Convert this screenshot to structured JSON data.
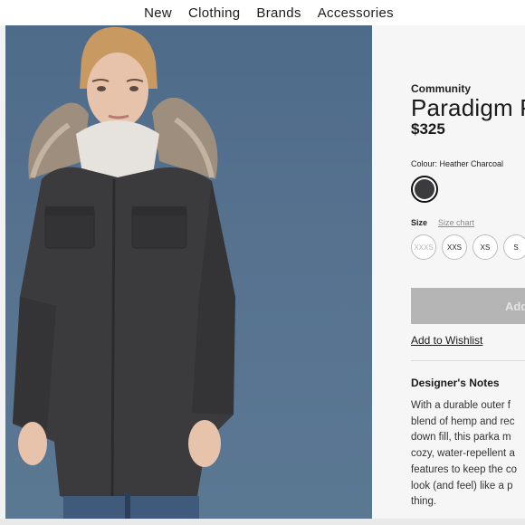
{
  "nav": {
    "items": [
      "New",
      "Clothing",
      "Brands",
      "Accessories"
    ]
  },
  "product": {
    "brand": "Community",
    "title": "Paradigm P",
    "price": "$325",
    "colour_label": "Colour: Heather Charcoal",
    "swatch_color": "#3b3a3c",
    "size_label": "Size",
    "size_chart": "Size chart",
    "sizes": [
      {
        "label": "XXXS",
        "available": false
      },
      {
        "label": "XXS",
        "available": true
      },
      {
        "label": "XS",
        "available": true
      },
      {
        "label": "S",
        "available": true
      }
    ],
    "add_button": "Add",
    "wishlist": "Add to Wishlist"
  },
  "notes": {
    "heading": "Designer's Notes",
    "lines": [
      "With a durable outer f",
      "blend of hemp and rec",
      "down fill, this parka m",
      "cozy, water-repellent a",
      "features to keep the co",
      "look (and feel) like a p",
      "thing."
    ]
  },
  "colors": {
    "photo_bg": "#56728f",
    "coat": "#3b3a3c",
    "button_disabled": "#b5b5b5"
  }
}
